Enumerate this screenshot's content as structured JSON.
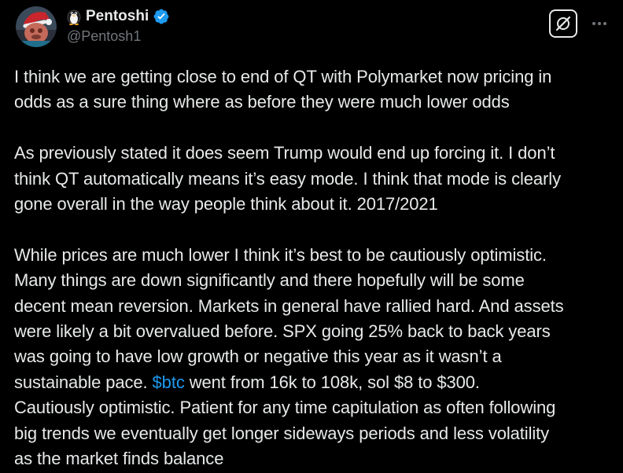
{
  "author": {
    "emoji": "penguin",
    "display_name": "Pentoshi",
    "handle": "@Pentosh1",
    "verified": true,
    "verified_color": "#1d9bf0"
  },
  "header": {
    "grok_icon": "grok-slash-icon",
    "more_icon": "more-horizontal-icon"
  },
  "tweet": {
    "paragraphs": [
      {
        "lines": [
          "I think we are getting close to end of QT with Polymarket now pricing in",
          "odds as a sure thing where as before they were much lower odds"
        ]
      },
      {
        "lines": [
          "As previously stated it does seem Trump would end up forcing it. I don’t",
          "think QT automatically means it’s easy mode. I think that mode is clearly",
          "gone overall in the way people think about it. 2017/2021"
        ]
      },
      {
        "lines_before": [
          "While prices are much lower I think it’s best to be cautiously optimistic.",
          "Many things are down significantly and there hopefully will be some",
          "decent mean reversion. Markets in general have rallied hard. And assets",
          "were likely a bit overvalued before. SPX going 25% back to back years",
          "was going to have low growth or negative this year as it wasn’t a"
        ],
        "cashtag_line_prefix": "sustainable pace. ",
        "cashtag": "$btc",
        "cashtag_line_suffix": " went from 16k to 108k, sol $8 to $300.",
        "lines_after": [
          "Cautiously optimistic. Patient for any time capitulation as often following",
          "big trends we eventually get longer sideways periods and less volatility",
          "as the market finds balance"
        ]
      }
    ]
  },
  "colors": {
    "background": "#000000",
    "text": "#e7e9ea",
    "secondary": "#71767b",
    "link": "#1d9bf0"
  }
}
